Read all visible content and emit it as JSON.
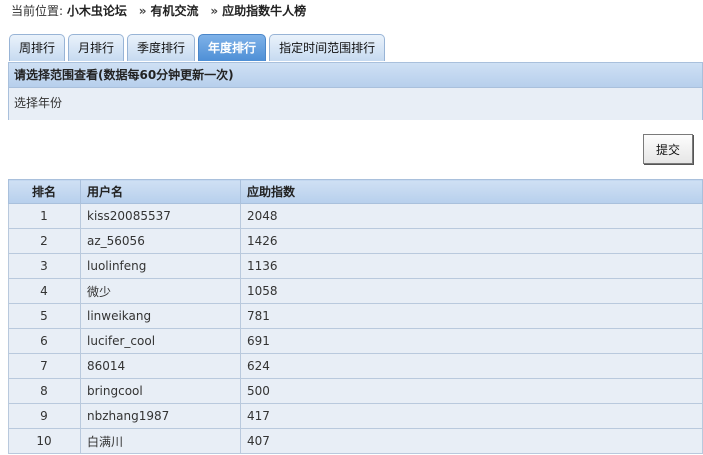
{
  "breadcrumb": {
    "prefix": "当前位置:",
    "items": [
      "小木虫论坛",
      "有机交流",
      "应助指数牛人榜"
    ],
    "separator": "»"
  },
  "tabs": [
    {
      "label": "周排行",
      "active": false
    },
    {
      "label": "月排行",
      "active": false
    },
    {
      "label": "季度排行",
      "active": false
    },
    {
      "label": "年度排行",
      "active": true
    },
    {
      "label": "指定时间范围排行",
      "active": false
    }
  ],
  "range": {
    "title": "请选择范围查看(数据每60分钟更新一次)",
    "year_label": "选择年份"
  },
  "submit_label": "提交",
  "table": {
    "headers": [
      "排名",
      "用户名",
      "应助指数"
    ],
    "rows": [
      [
        "1",
        "kiss20085537",
        "2048"
      ],
      [
        "2",
        "az_56056",
        "1426"
      ],
      [
        "3",
        "luolinfeng",
        "1136"
      ],
      [
        "4",
        "微少",
        "1058"
      ],
      [
        "5",
        "linweikang",
        "781"
      ],
      [
        "6",
        "lucifer_cool",
        "691"
      ],
      [
        "7",
        "86014",
        "624"
      ],
      [
        "8",
        "bringcool",
        "500"
      ],
      [
        "9",
        "nbzhang1987",
        "417"
      ],
      [
        "10",
        "白满川",
        "407"
      ]
    ]
  },
  "colors": {
    "tab_active": "#4e8fd6",
    "header_bg": "#b7cfec",
    "row_bg": "#e8eef6",
    "border": "#a9c0dc"
  }
}
